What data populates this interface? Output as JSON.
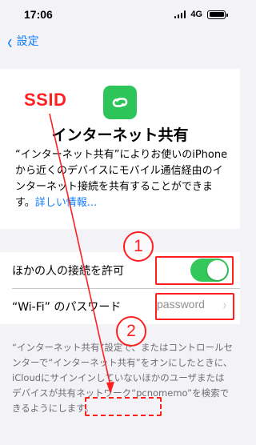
{
  "status_bar": {
    "time": "17:06",
    "network": "4G"
  },
  "nav": {
    "back_label": "設定",
    "back_icon": "chevron-left-icon"
  },
  "header": {
    "icon": "link-icon",
    "icon_color": "#2dc45a",
    "title": "インターネット共有",
    "description": "“インターネット共有”によりお使いのiPhoneから近くのデバイスにモバイル通信経由のインターネット接続を共有することができます。",
    "link": "詳しい情報..."
  },
  "settings": {
    "allow_others_label": "ほかの人の接続を許可",
    "allow_others_on": true,
    "wifi_password_label": "“Wi-Fi” のパスワード",
    "wifi_password_value": "password"
  },
  "footer": {
    "text_before": "“インターネット共有”設定で、またはコントロールセンターで“インターネット共有”をオンにしたときに、iCloudにサインインしていないほかのユーザまたはデバイスが共有ネットワーク",
    "network_name": "“pcnomemo”",
    "text_after": "を検索できるようにします。"
  },
  "annotations": {
    "ssid_label": "SSID",
    "step_1": "1",
    "step_2": "2",
    "accent_color": "#ff1f1f"
  }
}
